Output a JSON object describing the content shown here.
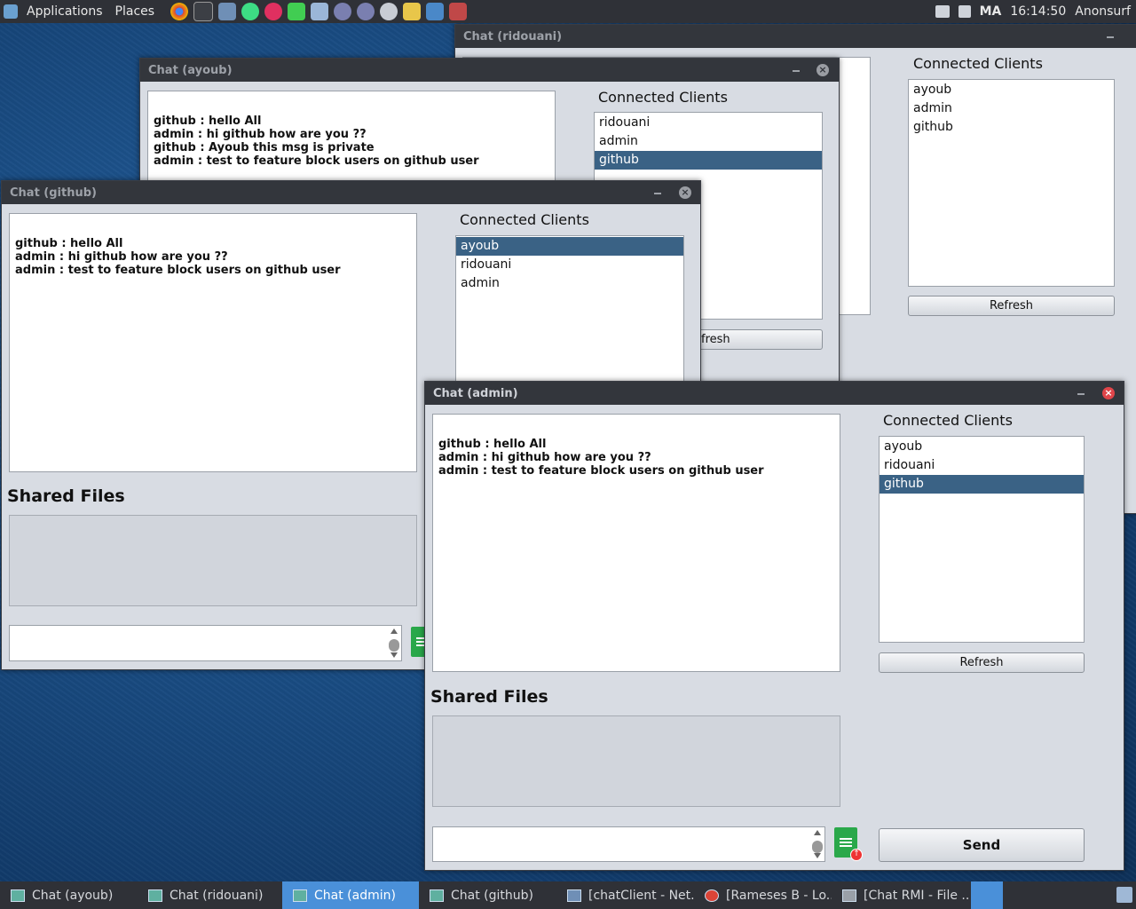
{
  "top_panel": {
    "applications": "Applications",
    "places": "Places",
    "launchers": [
      "chrome-icon",
      "terminal-icon",
      "virtualbox-icon",
      "android-studio-icon",
      "flickr-icon",
      "qt-icon",
      "cube-icon",
      "toggle-icon",
      "toggle2-icon",
      "hex-icon",
      "notes-icon",
      "image-viewer-icon",
      "screenshot-icon"
    ],
    "lang": "MA",
    "clock": "16:14:50",
    "anon": "Anonsurf"
  },
  "win_ridouani": {
    "title": "Chat (ridouani)",
    "clients_label": "Connected Clients",
    "clients": [
      "ayoub",
      "admin",
      "github"
    ],
    "refresh": "Refresh"
  },
  "win_ayoub": {
    "title": "Chat (ayoub)",
    "messages": "github : hello All\nadmin : hi github how are you ??\ngithub : Ayoub this msg is private\nadmin : test to feature block users on github user",
    "clients_label": "Connected Clients",
    "clients": [
      "ridouani",
      "admin",
      "github"
    ],
    "refresh_partial": "fresh"
  },
  "win_github": {
    "title": "Chat (github)",
    "messages": "github : hello All\nadmin : hi github how are you ??\nadmin : test to feature block users on github user",
    "clients_label": "Connected Clients",
    "clients": [
      "ayoub",
      "ridouani",
      "admin"
    ],
    "shared_files": "Shared Files"
  },
  "win_admin": {
    "title": "Chat (admin)",
    "messages": "github : hello All\nadmin : hi github how are you ??\nadmin : test to feature block users on github user",
    "clients_label": "Connected Clients",
    "clients": [
      "ayoub",
      "ridouani",
      "github"
    ],
    "refresh": "Refresh",
    "shared_files": "Shared Files",
    "send": "Send"
  },
  "taskbar": {
    "items": [
      "Chat (ayoub)",
      "Chat (ridouani)",
      "Chat (admin)",
      "Chat (github)",
      "[chatClient - Net...",
      "[Rameses B - Lo...",
      "[Chat RMI - File ..."
    ]
  },
  "colors": {
    "selection": "#3a6285",
    "active_task": "#4a90d9",
    "close_active": "#e0454a"
  }
}
